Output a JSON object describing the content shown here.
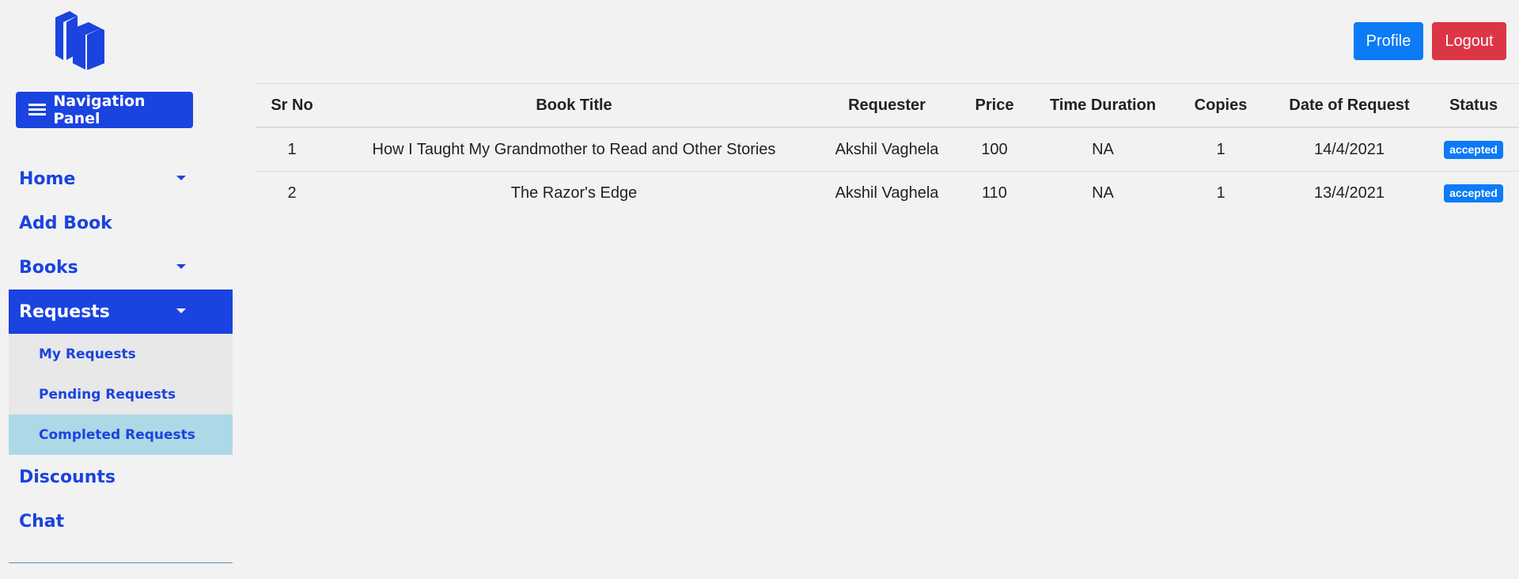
{
  "sidebar": {
    "nav_panel_label": "Navigation Panel",
    "items": [
      {
        "label": "Home"
      },
      {
        "label": "Add Book"
      },
      {
        "label": "Books"
      },
      {
        "label": "Requests"
      },
      {
        "label": "Discounts"
      },
      {
        "label": "Chat"
      }
    ],
    "requests_submenu": [
      {
        "label": "My Requests"
      },
      {
        "label": "Pending Requests"
      },
      {
        "label": "Completed Requests"
      }
    ]
  },
  "header": {
    "profile_label": "Profile",
    "logout_label": "Logout"
  },
  "table": {
    "columns": [
      "Sr No",
      "Book Title",
      "Requester",
      "Price",
      "Time Duration",
      "Copies",
      "Date of Request",
      "Status"
    ],
    "rows": [
      [
        "1",
        "How I Taught My Grandmother to Read and Other Stories",
        "Akshil Vaghela",
        "100",
        "NA",
        "1",
        "14/4/2021",
        "accepted"
      ],
      [
        "2",
        "The Razor's Edge",
        "Akshil Vaghela",
        "110",
        "NA",
        "1",
        "13/4/2021",
        "accepted"
      ]
    ]
  },
  "colors": {
    "brand": "#1a43e0",
    "primary": "#0b7bf6",
    "danger": "#dc3545",
    "selected_sub": "#add8e6"
  },
  "icons": {
    "logo": "books-icon",
    "nav_panel": "hamburger-icon",
    "caret": "caret-down-icon"
  }
}
